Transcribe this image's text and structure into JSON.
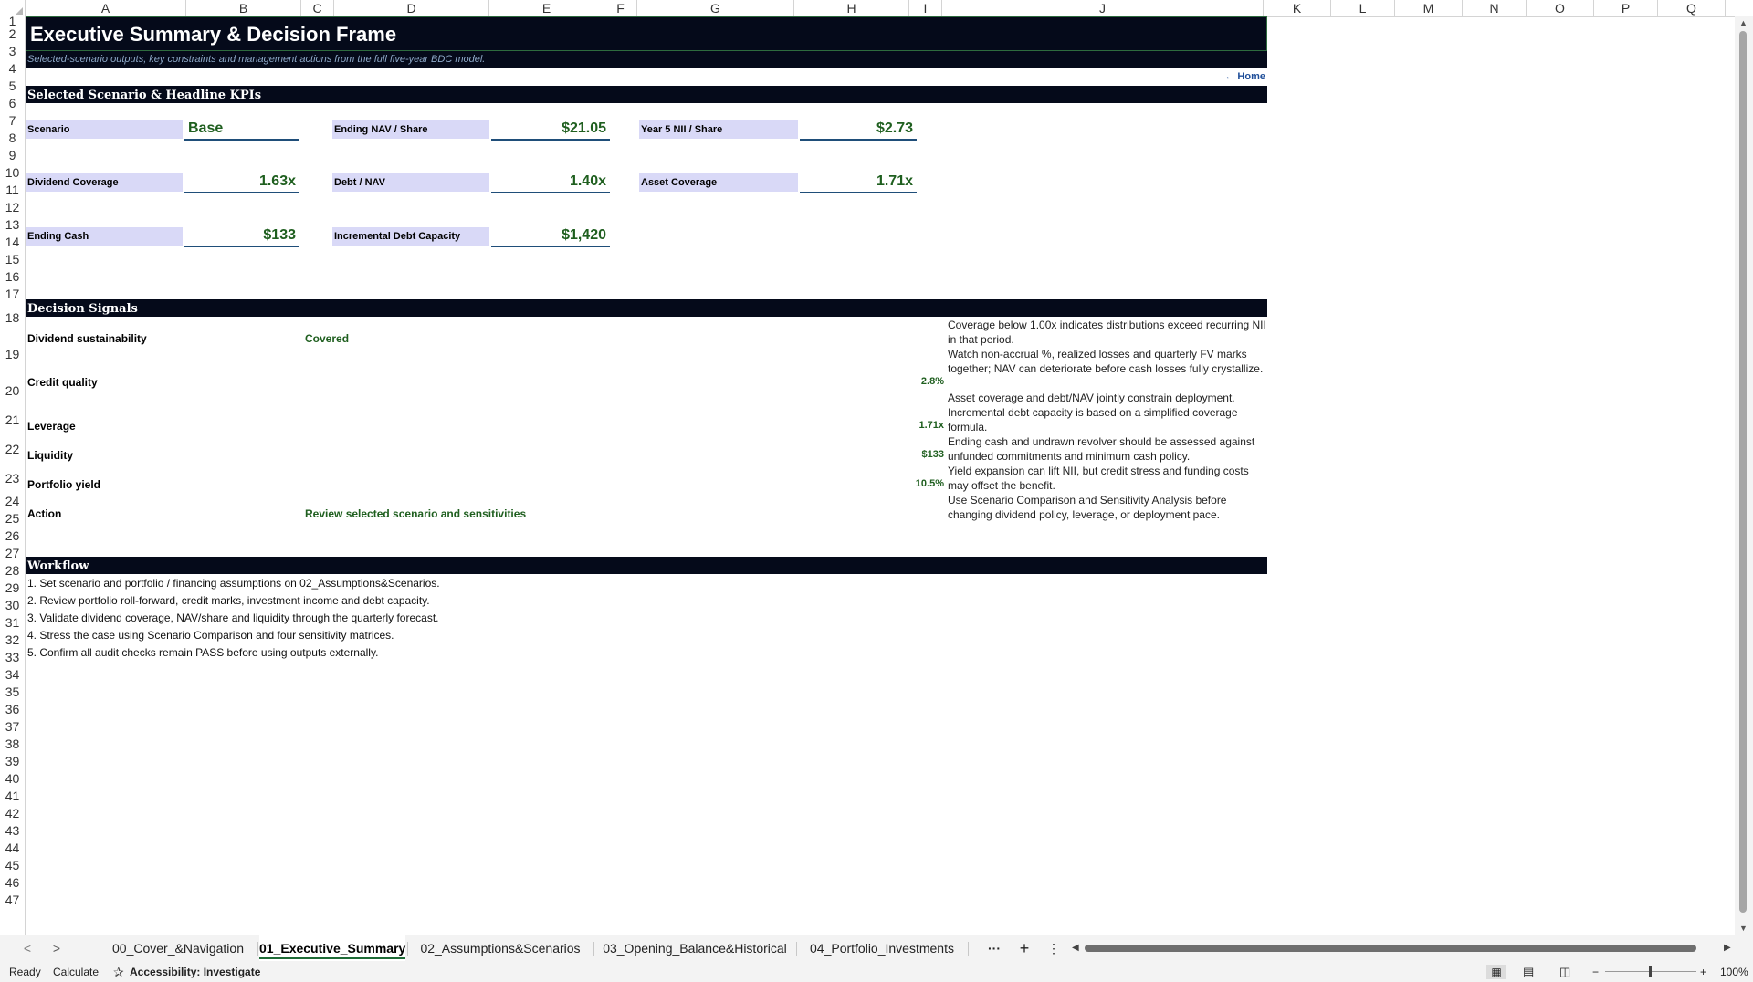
{
  "columns": [
    "A",
    "B",
    "C",
    "D",
    "E",
    "F",
    "G",
    "H",
    "I",
    "J",
    "K",
    "L",
    "M",
    "N",
    "O",
    "P",
    "Q"
  ],
  "rows": [
    "1",
    "2",
    "3",
    "4",
    "5",
    "6",
    "7",
    "8",
    "9",
    "10",
    "11",
    "12",
    "13",
    "14",
    "15",
    "16",
    "17",
    "18",
    "19",
    "20",
    "21",
    "22",
    "23",
    "24",
    "25",
    "26",
    "27",
    "28",
    "29",
    "30",
    "31",
    "32",
    "33",
    "34",
    "35",
    "36",
    "37",
    "38",
    "39",
    "40",
    "41",
    "42",
    "43",
    "44",
    "45",
    "46",
    "47"
  ],
  "header": {
    "title": "Executive Summary & Decision Frame",
    "subtitle": "Selected-scenario outputs, key constraints and management actions from the full five-year BDC model.",
    "home_link": "← Home"
  },
  "kpi_section": {
    "title": "Selected Scenario & Headline KPIs",
    "items": [
      {
        "label": "Scenario",
        "value": "Base"
      },
      {
        "label": "Ending NAV / Share",
        "value": "$21.05"
      },
      {
        "label": "Year 5 NII / Share",
        "value": "$2.73"
      },
      {
        "label": "Dividend Coverage",
        "value": "1.63x"
      },
      {
        "label": "Debt / NAV",
        "value": "1.40x"
      },
      {
        "label": "Asset Coverage",
        "value": "1.71x"
      },
      {
        "label": "Ending Cash",
        "value": "$133"
      },
      {
        "label": "Incremental Debt Capacity",
        "value": "$1,420"
      }
    ]
  },
  "signals_section": {
    "title": "Decision Signals",
    "items": [
      {
        "label": "Dividend sustainability",
        "status": "Covered",
        "metric": "",
        "note": "Coverage below 1.00x indicates distributions exceed recurring NII in that period."
      },
      {
        "label": "Credit quality",
        "status": "",
        "metric": "2.8%",
        "note": "Watch non-accrual %, realized losses and quarterly FV marks together; NAV can deteriorate before cash losses fully crystallize."
      },
      {
        "label": "Leverage",
        "status": "",
        "metric": "1.71x",
        "note": "Asset coverage and debt/NAV jointly constrain deployment. Incremental debt capacity is based on a simplified coverage formula."
      },
      {
        "label": "Liquidity",
        "status": "",
        "metric": "$133",
        "note": "Ending cash and undrawn revolver should be assessed against unfunded commitments and minimum cash policy."
      },
      {
        "label": "Portfolio yield",
        "status": "",
        "metric": "10.5%",
        "note": "Yield expansion can lift NII, but credit stress and funding costs may offset the benefit."
      },
      {
        "label": "Action",
        "status": "Review selected scenario and sensitivities",
        "metric": "",
        "note": "Use Scenario Comparison and Sensitivity Analysis before changing dividend policy, leverage, or deployment pace."
      }
    ]
  },
  "workflow_section": {
    "title": "Workflow",
    "steps": [
      "1. Set scenario and portfolio / financing assumptions on 02_Assumptions&Scenarios.",
      "2. Review portfolio roll-forward, credit marks, investment income and debt capacity.",
      "3. Validate dividend coverage, NAV/share and liquidity through the quarterly forecast.",
      "4. Stress the case using Scenario Comparison and four sensitivity matrices.",
      "5. Confirm all audit checks remain PASS before using outputs externally."
    ]
  },
  "tabs": {
    "prev": "<",
    "next": ">",
    "sheets": [
      "00_Cover_&Navigation",
      "01_Executive_Summary",
      "02_Assumptions&Scenarios",
      "03_Opening_Balance&Historical",
      "04_Portfolio_Investments"
    ],
    "more": "···",
    "add": "+",
    "menu": "⋮"
  },
  "status": {
    "ready": "Ready",
    "calculate": "Calculate",
    "accessibility": "Accessibility: Investigate",
    "zoom": "100%"
  }
}
